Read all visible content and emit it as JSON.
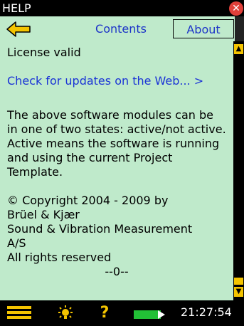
{
  "window": {
    "title": "HELP"
  },
  "nav": {
    "contents_tab": "Contents",
    "about_tab": "About"
  },
  "content": {
    "lines": [
      "License valid",
      "Check for updates on the Web... >",
      "The above software modules can be",
      "in one of two states: active/not active.",
      "Active means the software is running",
      "and using the current Project",
      "Template.",
      "© Copyright 2004 - 2009 by",
      "Brüel & Kjær",
      "Sound & Vibration Measurement",
      "A/S",
      "All rights reserved",
      "--0--"
    ]
  },
  "status": {
    "time": "21:27:54",
    "help_glyph": "?"
  },
  "icons": {
    "close": "close-icon",
    "back": "back-arrow-icon",
    "menu": "menu-icon",
    "bulb": "bulb-icon",
    "help": "help-icon",
    "battery": "battery-icon"
  },
  "colors": {
    "background": "#bfeacb",
    "accent": "#f4c400",
    "link": "#1b34d6",
    "close": "#e0403a"
  }
}
